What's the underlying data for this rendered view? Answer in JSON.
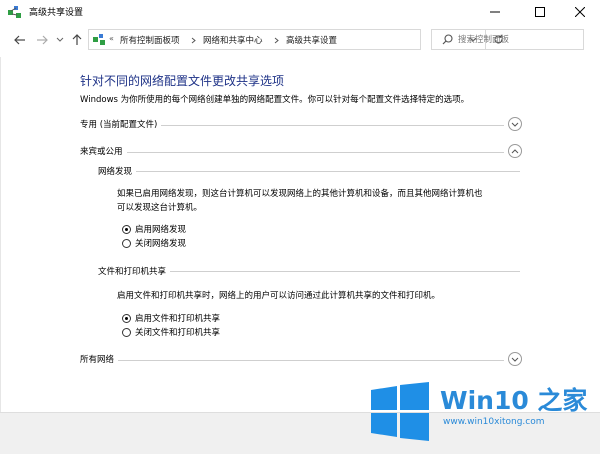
{
  "window": {
    "title": "高级共享设置",
    "buttons": {
      "minimize": "minimize-icon",
      "maximize": "maximize-icon",
      "close": "close-icon"
    }
  },
  "nav": {
    "breadcrumb_prefix": "«",
    "breadcrumbs": [
      "所有控制面板项",
      "网络和共享中心",
      "高级共享设置"
    ],
    "search": {
      "placeholder": "搜索控制面板"
    }
  },
  "content": {
    "heading": "针对不同的网络配置文件更改共享选项",
    "description": "Windows 为你所使用的每个网络创建单独的网络配置文件。你可以针对每个配置文件选择特定的选项。",
    "profiles": {
      "private": {
        "label": "专用 (当前配置文件)",
        "expanded": false
      },
      "guest_public": {
        "label": "来宾或公用",
        "expanded": true,
        "network_discovery": {
          "title": "网络发现",
          "description_line1": "如果已启用网络发现，则这台计算机可以发现网络上的其他计算机和设备，而且其他网络计算机也",
          "description_line2": "可以发现这台计算机。",
          "options": [
            {
              "label": "启用网络发现",
              "selected": true
            },
            {
              "label": "关闭网络发现",
              "selected": false
            }
          ]
        },
        "file_printer_sharing": {
          "title": "文件和打印机共享",
          "description": "启用文件和打印机共享时，网络上的用户可以访问通过此计算机共享的文件和打印机。",
          "options": [
            {
              "label": "启用文件和打印机共享",
              "selected": true
            },
            {
              "label": "关闭文件和打印机共享",
              "selected": false
            }
          ]
        }
      },
      "all_networks": {
        "label": "所有网络",
        "expanded": false
      }
    }
  },
  "watermark": {
    "brand": "Win10 之家",
    "url": "www.win10xitong.com",
    "colors": {
      "blue": "#2a8ad8",
      "logo": "#1f8fe6"
    }
  },
  "colors": {
    "heading": "#1e3287"
  }
}
